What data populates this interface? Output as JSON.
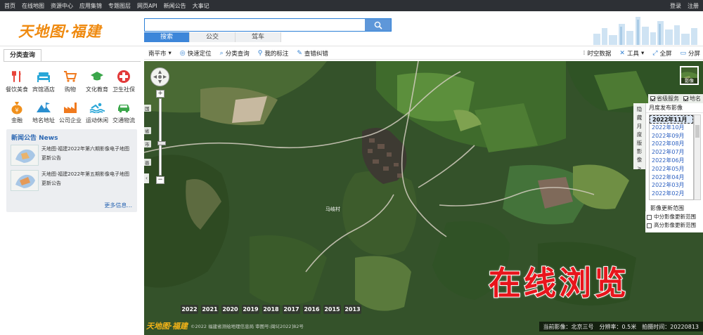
{
  "topbar": {
    "nav": [
      "首页",
      "在线地图",
      "资源中心",
      "应用集锦",
      "专题图层",
      "网页API",
      "新闻公告",
      "大事记"
    ],
    "login": "登录",
    "register": "注册"
  },
  "header": {
    "logo": "天地图·福建",
    "search_placeholder": "",
    "search_tabs": [
      "搜索",
      "公交",
      "驾车"
    ]
  },
  "toolbar": {
    "left": [
      "南平市",
      "快速定位",
      "分类查询",
      "我的标注",
      "查错纠错"
    ],
    "right": [
      "时空数据",
      "工具",
      "全屏",
      "分屏"
    ]
  },
  "sidebar": {
    "tab": "分类查询",
    "categories": [
      {
        "label": "餐饮美食",
        "icon": "fork-knife-icon",
        "color": "#e8443a"
      },
      {
        "label": "宾馆酒店",
        "icon": "bed-icon",
        "color": "#2aa7d8"
      },
      {
        "label": "购物",
        "icon": "cart-icon",
        "color": "#f07a1e"
      },
      {
        "label": "文化教育",
        "icon": "graduation-cap-icon",
        "color": "#3aa64a"
      },
      {
        "label": "卫生社保",
        "icon": "medical-cross-icon",
        "color": "#e23a3a"
      },
      {
        "label": "金融",
        "icon": "money-bag-icon",
        "color": "#f0901c"
      },
      {
        "label": "地名地址",
        "icon": "mountain-icon",
        "color": "#2a8fd0"
      },
      {
        "label": "公司企业",
        "icon": "factory-icon",
        "color": "#f07a1e"
      },
      {
        "label": "运动休闲",
        "icon": "swimming-icon",
        "color": "#2aa7d8"
      },
      {
        "label": "交通物流",
        "icon": "car-icon",
        "color": "#3aa64a"
      }
    ],
    "news": {
      "title": "新闻公告 News",
      "items": [
        {
          "title": "天地图·福建2022年第六期影像电子地图",
          "subtitle": "更新公告"
        },
        {
          "title": "天地图·福建2022年第五期影像电子地图",
          "subtitle": "更新公告"
        }
      ],
      "more": "更多信息..."
    }
  },
  "map": {
    "layer_thumb_label": "影像",
    "layer_checks": [
      {
        "label": "省级服务",
        "checked": true
      },
      {
        "label": "地名",
        "checked": true
      }
    ],
    "hide_tab": "隐藏月度版影像>",
    "month_panel_title": "月度发布影像",
    "months": [
      "2022年11月",
      "2022年10月",
      "2022年09月",
      "2022年08月",
      "2022年07月",
      "2022年06月",
      "2022年05月",
      "2022年04月",
      "2022年03月",
      "2022年02月"
    ],
    "selected_month": "2022年11月",
    "range_label": "影像更新范围",
    "range_options": [
      "中分影像更新范围",
      "高分影像更新范围"
    ],
    "zoom_levels": [
      "国",
      "省",
      "市",
      "县"
    ],
    "place_label": "马岐村",
    "overlay_text": "在线浏览",
    "years": [
      "2022",
      "2021",
      "2020",
      "2019",
      "2018",
      "2017",
      "2016",
      "2015",
      "2013"
    ],
    "logo": "天地图·福建",
    "credit": "©2022 福建省测绘地理信息局 审图号:闽S[2022]82号",
    "status": {
      "source": "当前影像：北京三号",
      "resolution": "分辨率：0.5米",
      "date": "拍摄时间：20220813"
    }
  }
}
